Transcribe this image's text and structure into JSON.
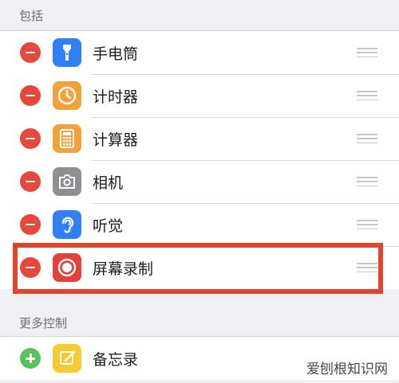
{
  "sections": {
    "included": {
      "title": "包括",
      "items": [
        {
          "label": "手电筒",
          "icon": "flashlight-icon",
          "color": "#2f80f6"
        },
        {
          "label": "计时器",
          "icon": "timer-icon",
          "color": "#f1a23a"
        },
        {
          "label": "计算器",
          "icon": "calculator-icon",
          "color": "#f1a23a"
        },
        {
          "label": "相机",
          "icon": "camera-icon",
          "color": "#8e8e93"
        },
        {
          "label": "听觉",
          "icon": "hearing-icon",
          "color": "#2f80f6"
        },
        {
          "label": "屏幕录制",
          "icon": "screen-recording-icon",
          "color": "#e5413a"
        }
      ]
    },
    "more": {
      "title": "更多控制",
      "items": [
        {
          "label": "备忘录",
          "icon": "notes-icon",
          "color": "#f7c933"
        }
      ]
    }
  },
  "colors": {
    "remove": "#e8473c",
    "add": "#57c35a",
    "highlight": "#e2452d"
  },
  "watermark": "爱刨根知识网"
}
